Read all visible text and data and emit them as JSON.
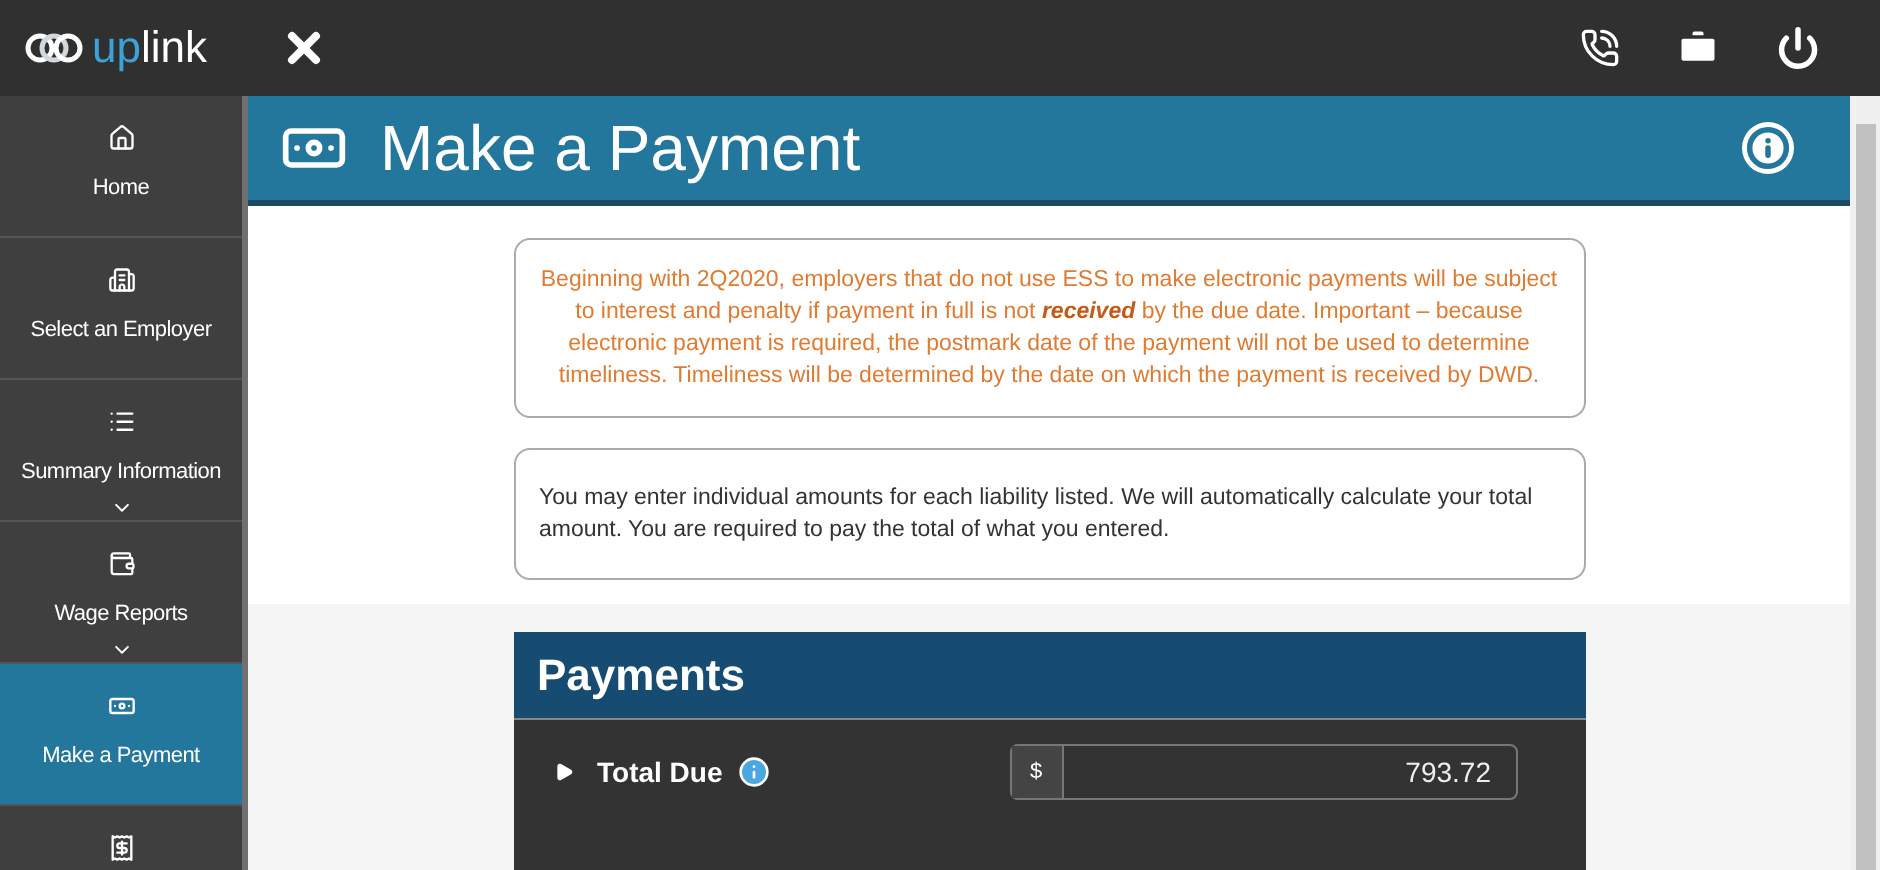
{
  "topbar": {
    "logo_prefix": "up",
    "logo_suffix": "link"
  },
  "sidebar": {
    "items": [
      {
        "label": "Home",
        "selected": false,
        "expandable": false
      },
      {
        "label": "Select an Employer",
        "selected": false,
        "expandable": false
      },
      {
        "label": "Summary Information",
        "selected": false,
        "expandable": true
      },
      {
        "label": "Wage Reports",
        "selected": false,
        "expandable": true
      },
      {
        "label": "Make a Payment",
        "selected": true,
        "expandable": false
      },
      {
        "selected": false,
        "expandable": false
      }
    ]
  },
  "page": {
    "title": "Make a Payment"
  },
  "notices": [
    {
      "kind": "warning",
      "text": "Beginning with 2Q2020, employers that do not use ESS to make electronic payments will be subject to interest and penalty if payment in full is not **received** by the due date. Important – because electronic payment is required, the postmark date of the payment will not be used to determine timeliness. Timeliness will be determined by the date on which the payment is received by DWD."
    },
    {
      "kind": "info",
      "text": "You may enter individual amounts for each liability listed. We will automatically calculate your total amount. You are required to pay the total of what you entered."
    }
  ],
  "payments": {
    "title": "Payments",
    "row": {
      "label": "Total Due",
      "expanded": false,
      "currency": "$",
      "value": "793.72"
    }
  }
}
